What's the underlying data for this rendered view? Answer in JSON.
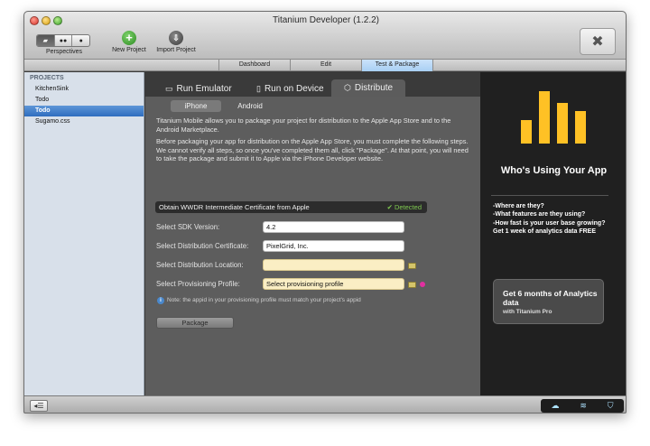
{
  "window": {
    "title": "Titanium Developer (1.2.2)"
  },
  "toolbar": {
    "perspectives_label": "Perspectives",
    "new_project_label": "New Project",
    "import_project_label": "Import Project",
    "new_project_icon": "plus-icon",
    "import_project_icon": "import-icon",
    "app_icon": "titanium-logo-icon"
  },
  "main_tabs": [
    {
      "label": "Dashboard",
      "active": false
    },
    {
      "label": "Edit",
      "active": false
    },
    {
      "label": "Test & Package",
      "active": true
    }
  ],
  "sidebar": {
    "header": "PROJECTS",
    "items": [
      {
        "label": "KitchenSink",
        "selected": false
      },
      {
        "label": "Todo",
        "selected": false
      },
      {
        "label": "Todo",
        "selected": true
      },
      {
        "label": "Sugamo.css",
        "selected": false
      }
    ]
  },
  "subtabs": [
    {
      "label": "Run Emulator",
      "icon": "monitor-icon",
      "active": false
    },
    {
      "label": "Run on Device",
      "icon": "phone-icon",
      "active": false
    },
    {
      "label": "Distribute",
      "icon": "box-icon",
      "active": true
    }
  ],
  "platform_tabs": [
    {
      "label": "iPhone",
      "active": true
    },
    {
      "label": "Android",
      "active": false
    }
  ],
  "distribute": {
    "intro": "Titanium Mobile allows you to package your project for distribution to the Apple App Store and to the Android Marketplace.",
    "steps_text": "Before packaging your app for distribution on the Apple App Store, you must complete the following steps. We cannot verify all steps, so once you've completed them all, click \"Package\". At that point, you will need to take the package and submit it to Apple via the iPhone Developer website.",
    "cert_step": "Obtain WWDR Intermediate Certificate from Apple",
    "cert_status": "Detected",
    "sdk_label": "Select SDK Version:",
    "sdk_value": "4.2",
    "cert_label": "Select Distribution Certificate:",
    "cert_value": "PixelGrid, Inc.",
    "location_label": "Select Distribution Location:",
    "location_value": "",
    "profile_label": "Select Provisioning Profile:",
    "profile_value": "Select provisioning profile",
    "note": "Note: the appid in your provisioning profile must match your project's appid",
    "package_button": "Package",
    "colors": {
      "detected": "#7ec94f",
      "field_highlight": "#faeec4"
    }
  },
  "ad": {
    "bar_levels": [
      0.45,
      1.0,
      0.78,
      0.62
    ],
    "bar_color": "#ffc125",
    "title": "Who's Using Your App",
    "bullets": [
      "-Where are they?",
      "-What features are they using?",
      "-How fast is your user base growing?",
      "Get 1 week of analytics data FREE"
    ],
    "box_title": "Get 6 months of Analytics data",
    "box_subtitle": "with Titanium Pro"
  },
  "statusbar": {
    "left_icon": "sidebar-toggle-icon",
    "right_icons": [
      "cloud-icon",
      "wifi-icon",
      "shield-icon"
    ]
  }
}
